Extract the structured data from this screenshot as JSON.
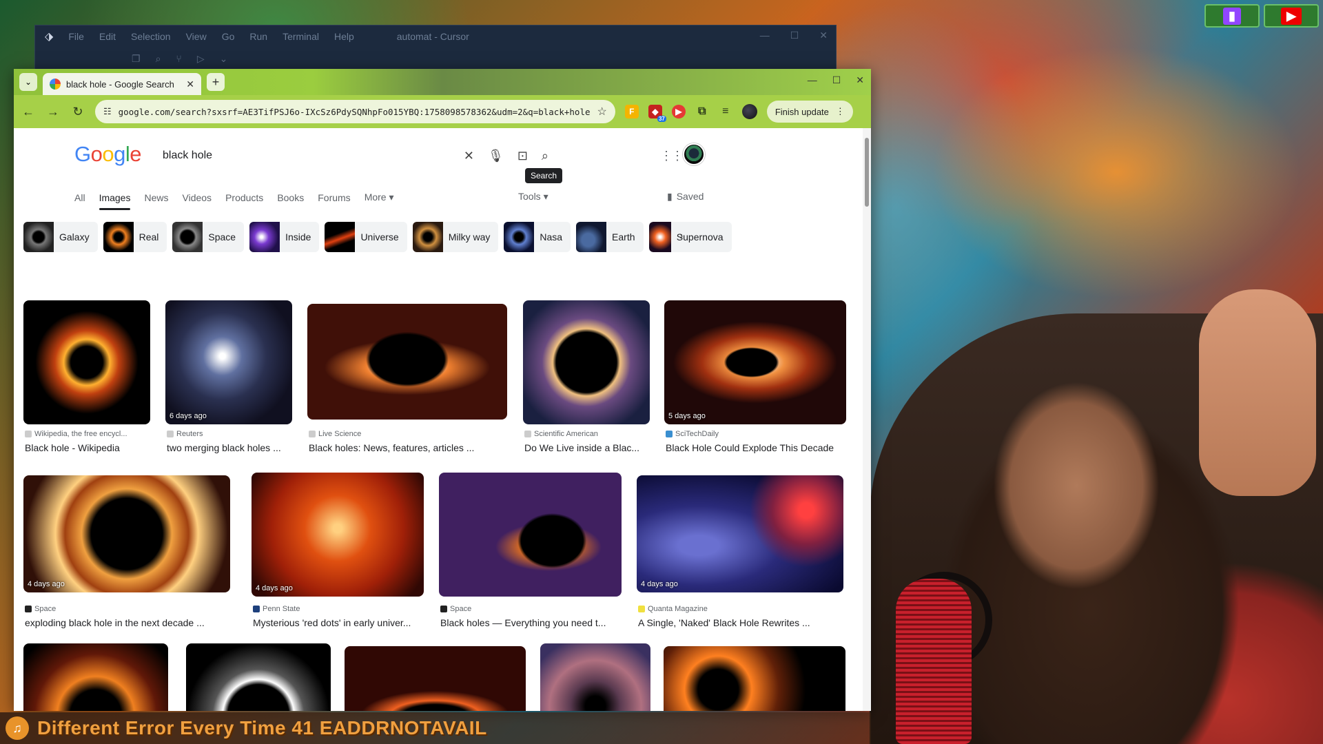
{
  "ide": {
    "menu": [
      "File",
      "Edit",
      "Selection",
      "View",
      "Go",
      "Run",
      "Terminal",
      "Help"
    ],
    "title": "automat - Cursor"
  },
  "browser": {
    "tab_title": "black hole - Google Search",
    "url": "google.com/search?sxsrf=AE3TifPSJ6o-IXcSz6PdySQNhpFo015YBQ:1758098578362&udm=2&q=black+hole",
    "ext_badge": "37",
    "finish_update": "Finish update"
  },
  "google": {
    "logo": [
      "G",
      "o",
      "o",
      "g",
      "l",
      "e"
    ],
    "query": "black hole",
    "tooltip": "Search",
    "tabs": [
      "All",
      "Images",
      "News",
      "Videos",
      "Products",
      "Books",
      "Forums",
      "More"
    ],
    "tools": "Tools",
    "saved": "Saved",
    "chips": [
      "Galaxy",
      "Real",
      "Space",
      "Inside",
      "Universe",
      "Milky way",
      "Nasa",
      "Earth",
      "Supernova"
    ]
  },
  "results": {
    "row1": [
      {
        "source": "Wikipedia, the free encycl...",
        "caption": "Black hole - Wikipedia",
        "age": ""
      },
      {
        "source": "Reuters",
        "caption": "two merging black holes ...",
        "age": "6 days ago"
      },
      {
        "source": "Live Science",
        "caption": "Black holes: News, features, articles ...",
        "age": ""
      },
      {
        "source": "Scientific American",
        "caption": "Do We Live inside a Blac...",
        "age": ""
      },
      {
        "source": "SciTechDaily",
        "caption": "Black Hole Could Explode This Decade",
        "age": "5 days ago"
      }
    ],
    "row2": [
      {
        "source": "Space",
        "caption": "exploding black hole in the next decade ...",
        "age": "4 days ago"
      },
      {
        "source": "Penn State",
        "caption": "Mysterious 'red dots' in early univer...",
        "age": "4 days ago"
      },
      {
        "source": "Space",
        "caption": "Black holes — Everything you need t...",
        "age": ""
      },
      {
        "source": "Quanta Magazine",
        "caption": "A Single, 'Naked' Black Hole Rewrites ...",
        "age": "4 days ago"
      }
    ]
  },
  "now_playing": "Different Error Every Time 41 EADDRNOTAVAIL",
  "colors": {
    "tab_strip": "#9bcd3f",
    "toolbar": "#a6d048",
    "google_blue": "#4285f4",
    "google_red": "#ea4335",
    "google_yellow": "#fbbc05",
    "google_green": "#34a853"
  }
}
